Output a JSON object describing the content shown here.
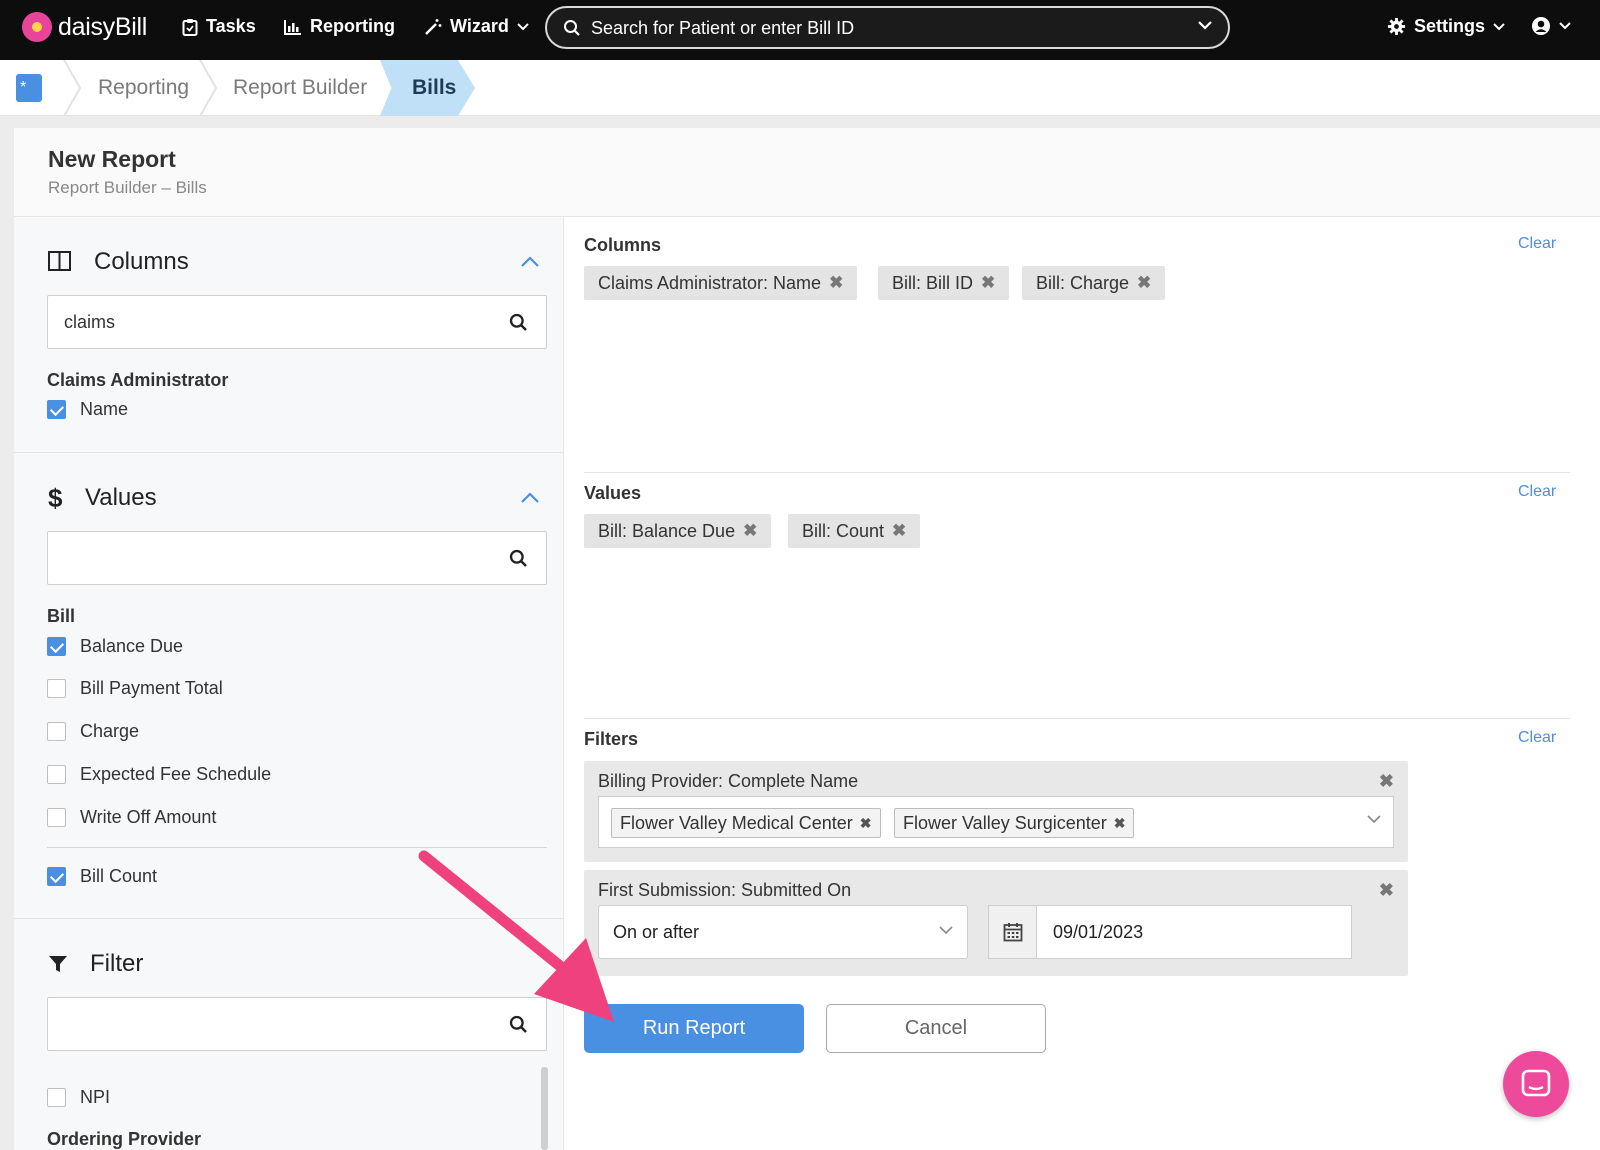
{
  "nav": {
    "brand": "daisyBill",
    "tasks": "Tasks",
    "reporting": "Reporting",
    "wizard": "Wizard",
    "search_placeholder": "Search for Patient or enter Bill ID",
    "settings": "Settings"
  },
  "breadcrumb": {
    "items": [
      "Reporting",
      "Report Builder"
    ],
    "active": "Bills"
  },
  "page": {
    "title": "New Report",
    "subtitle": "Report Builder – Bills"
  },
  "left": {
    "columns": {
      "title": "Columns",
      "search_value": "claims",
      "group": "Claims Administrator",
      "options": [
        {
          "label": "Name",
          "checked": true
        }
      ]
    },
    "values": {
      "title": "Values",
      "search_value": "",
      "group": "Bill",
      "options": [
        {
          "label": "Balance Due",
          "checked": true
        },
        {
          "label": "Bill Payment Total",
          "checked": false
        },
        {
          "label": "Charge",
          "checked": false
        },
        {
          "label": "Expected Fee Schedule",
          "checked": false
        },
        {
          "label": "Write Off Amount",
          "checked": false
        },
        {
          "label": "Bill Count",
          "checked": true
        }
      ]
    },
    "filter": {
      "title": "Filter",
      "search_value": "",
      "options": [
        {
          "label": "NPI",
          "checked": false
        }
      ],
      "next_group": "Ordering Provider"
    }
  },
  "right": {
    "columns": {
      "label": "Columns",
      "clear": "Clear",
      "pills": [
        "Claims Administrator: Name",
        "Bill: Bill ID",
        "Bill: Charge"
      ]
    },
    "values": {
      "label": "Values",
      "clear": "Clear",
      "pills": [
        "Bill: Balance Due",
        "Bill: Count"
      ]
    },
    "filters": {
      "label": "Filters",
      "clear": "Clear",
      "provider": {
        "title": "Billing Provider: Complete Name",
        "tags": [
          "Flower Valley Medical Center",
          "Flower Valley Surgicenter"
        ]
      },
      "submission": {
        "title": "First Submission: Submitted On",
        "operator": "On or after",
        "date": "09/01/2023"
      }
    }
  },
  "actions": {
    "run": "Run Report",
    "cancel": "Cancel"
  },
  "colors": {
    "accent": "#4a90e2",
    "annotation_arrow": "#f0417f",
    "chat": "#ee4a9b"
  }
}
